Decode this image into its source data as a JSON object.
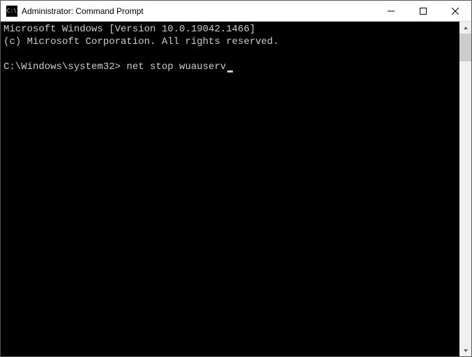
{
  "titlebar": {
    "icon_label": "C:\\",
    "title": "Administrator: Command Prompt"
  },
  "window_controls": {
    "minimize": "Minimize",
    "maximize": "Maximize",
    "close": "Close"
  },
  "console": {
    "line1": "Microsoft Windows [Version 10.0.19042.1466]",
    "line2": "(c) Microsoft Corporation. All rights reserved.",
    "blank": "",
    "prompt": "C:\\Windows\\system32>",
    "command": "net stop wuauserv"
  },
  "scrollbar": {
    "up": "Scroll up",
    "down": "Scroll down",
    "thumb": "Scroll thumb"
  }
}
